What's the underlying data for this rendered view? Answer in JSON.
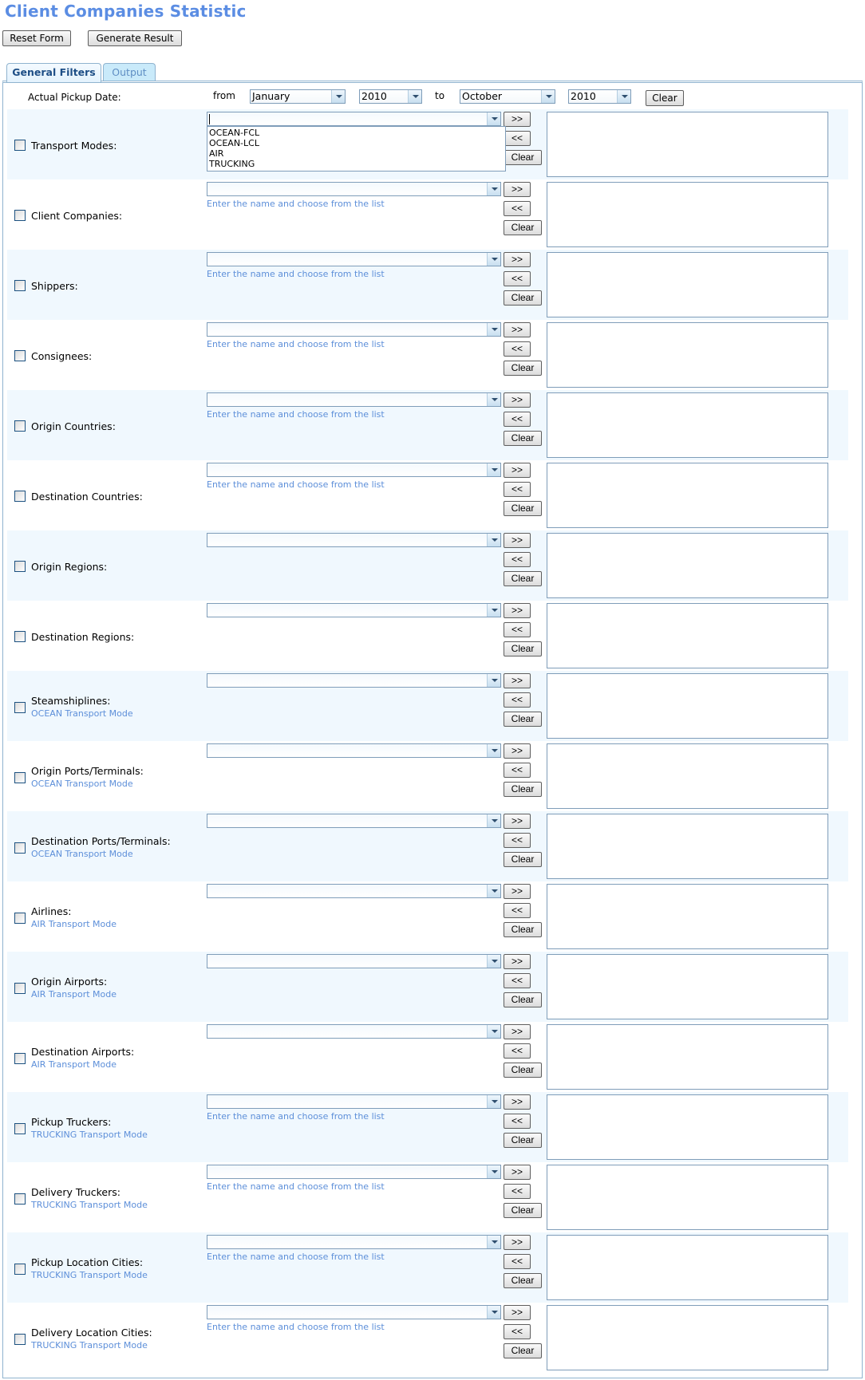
{
  "page": {
    "title": "Client Companies Statistic",
    "reset_label": "Reset Form",
    "generate_label": "Generate Result"
  },
  "tabs": [
    {
      "label": "General Filters",
      "active": true
    },
    {
      "label": "Output",
      "active": false
    }
  ],
  "date_filter": {
    "label": "Actual Pickup Date:",
    "from_word": "from",
    "to_word": "to",
    "from_month": "January",
    "from_year": "2010",
    "to_month": "October",
    "to_year": "2010",
    "clear_label": "Clear"
  },
  "common": {
    "add_label": ">>",
    "remove_label": "<<",
    "clear_label": "Clear",
    "hint": "Enter the name and choose from the list"
  },
  "transport_dropdown": {
    "options": [
      "OCEAN-FCL",
      "OCEAN-LCL",
      "AIR",
      "TRUCKING"
    ]
  },
  "filters": [
    {
      "label": "Transport Modes:",
      "sublabel": "",
      "hint": false,
      "checked": false
    },
    {
      "label": "Client Companies:",
      "sublabel": "",
      "hint": true,
      "checked": false
    },
    {
      "label": "Shippers:",
      "sublabel": "",
      "hint": true,
      "checked": false
    },
    {
      "label": "Consignees:",
      "sublabel": "",
      "hint": true,
      "checked": false
    },
    {
      "label": "Origin Countries:",
      "sublabel": "",
      "hint": true,
      "checked": false
    },
    {
      "label": "Destination Countries:",
      "sublabel": "",
      "hint": true,
      "checked": false
    },
    {
      "label": "Origin Regions:",
      "sublabel": "",
      "hint": false,
      "checked": false
    },
    {
      "label": "Destination Regions:",
      "sublabel": "",
      "hint": false,
      "checked": false
    },
    {
      "label": "Steamshiplines:",
      "sublabel": "OCEAN Transport Mode",
      "hint": false,
      "checked": false
    },
    {
      "label": "Origin Ports/Terminals:",
      "sublabel": "OCEAN Transport Mode",
      "hint": false,
      "checked": false
    },
    {
      "label": "Destination Ports/Terminals:",
      "sublabel": "OCEAN Transport Mode",
      "hint": false,
      "checked": false
    },
    {
      "label": "Airlines:",
      "sublabel": "AIR Transport Mode",
      "hint": false,
      "checked": false
    },
    {
      "label": "Origin Airports:",
      "sublabel": "AIR Transport Mode",
      "hint": false,
      "checked": false
    },
    {
      "label": "Destination Airports:",
      "sublabel": "AIR Transport Mode",
      "hint": false,
      "checked": false
    },
    {
      "label": "Pickup Truckers:",
      "sublabel": "TRUCKING Transport Mode",
      "hint": true,
      "checked": false
    },
    {
      "label": "Delivery Truckers:",
      "sublabel": "TRUCKING Transport Mode",
      "hint": true,
      "checked": false
    },
    {
      "label": "Pickup Location Cities:",
      "sublabel": "TRUCKING Transport Mode",
      "hint": true,
      "checked": false
    },
    {
      "label": "Delivery Location Cities:",
      "sublabel": "TRUCKING Transport Mode",
      "hint": true,
      "checked": false
    }
  ],
  "colors": {
    "title": "#5b8de3",
    "hint": "#5d8fd9",
    "row_shade": "#f0f8fe",
    "border": "#8fb3cf"
  }
}
